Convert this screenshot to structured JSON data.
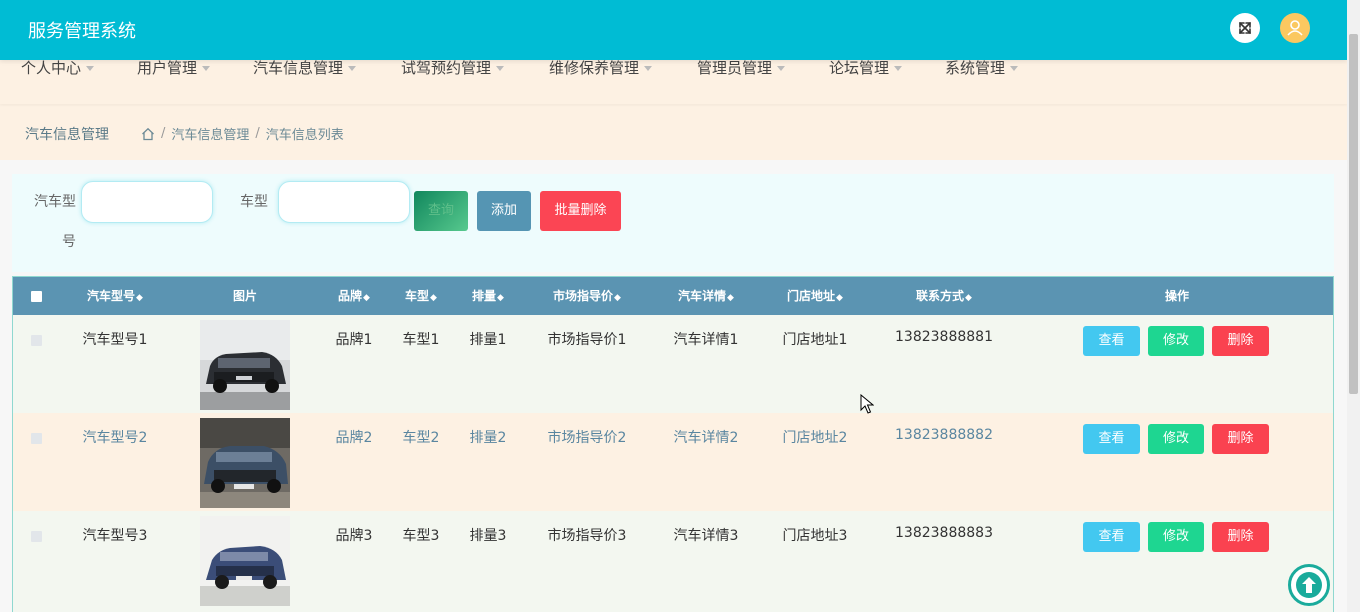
{
  "app": {
    "title": "服务管理系统"
  },
  "nav": [
    {
      "label": "个人中心"
    },
    {
      "label": "用户管理"
    },
    {
      "label": "汽车信息管理"
    },
    {
      "label": "试驾预约管理"
    },
    {
      "label": "维修保养管理"
    },
    {
      "label": "管理员管理"
    },
    {
      "label": "论坛管理"
    },
    {
      "label": "系统管理"
    }
  ],
  "breadcrumb": {
    "page_name": "汽车信息管理",
    "sep": "/",
    "items": [
      "汽车信息管理",
      "汽车信息列表"
    ]
  },
  "search": {
    "model_label": "汽车型号",
    "type_label": "车型",
    "model_value": "",
    "type_value": "",
    "query_btn": "查询",
    "add_btn": "添加",
    "batch_delete_btn": "批量删除"
  },
  "table": {
    "headers": [
      "汽车型号",
      "图片",
      "品牌",
      "车型",
      "排量",
      "市场指导价",
      "汽车详情",
      "门店地址",
      "联系方式",
      "操作"
    ],
    "rows": [
      {
        "model": "汽车型号1",
        "brand": "品牌1",
        "type": "车型1",
        "displacement": "排量1",
        "price": "市场指导价1",
        "detail": "汽车详情1",
        "address": "门店地址1",
        "contact": "13823888881"
      },
      {
        "model": "汽车型号2",
        "brand": "品牌2",
        "type": "车型2",
        "displacement": "排量2",
        "price": "市场指导价2",
        "detail": "汽车详情2",
        "address": "门店地址2",
        "contact": "13823888882"
      },
      {
        "model": "汽车型号3",
        "brand": "品牌3",
        "type": "车型3",
        "displacement": "排量3",
        "price": "市场指导价3",
        "detail": "汽车详情3",
        "address": "门店地址3",
        "contact": "13823888883"
      }
    ],
    "actions": {
      "view": "查看",
      "edit": "修改",
      "delete": "删除"
    }
  },
  "colors": {
    "header_bg": "#00bcd4",
    "band_bg": "#fdf1e3",
    "table_head_bg": "#5b94b2",
    "view_btn": "#43c8f0",
    "edit_btn": "#1ed691",
    "delete_btn": "#fa4250"
  },
  "icons": [
    "fullscreen-icon",
    "user-avatar-icon",
    "home-icon",
    "sort-icon",
    "car-photo",
    "cursor-icon",
    "back-to-top-icon"
  ]
}
